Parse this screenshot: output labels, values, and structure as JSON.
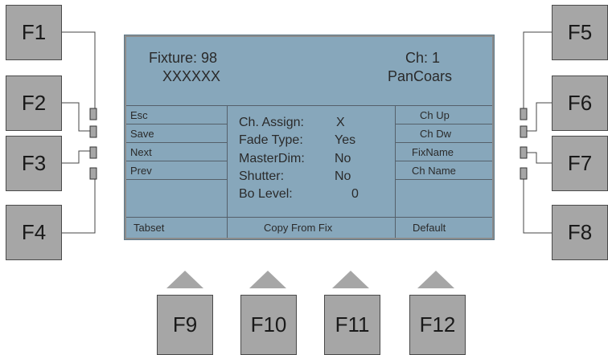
{
  "function_keys": {
    "f1": "F1",
    "f2": "F2",
    "f3": "F3",
    "f4": "F4",
    "f5": "F5",
    "f6": "F6",
    "f7": "F7",
    "f8": "F8",
    "f9": "F9",
    "f10": "F10",
    "f11": "F11",
    "f12": "F12"
  },
  "display": {
    "fixture_label": "Fixture: 98",
    "fixture_name": "XXXXXX",
    "channel_label": "Ch: 1",
    "channel_name": "PanCoars",
    "left_softkeys": [
      "Esc",
      "Save",
      "Next",
      "Prev",
      ""
    ],
    "right_softkeys": [
      "Ch Up",
      "Ch Dw",
      "FixName",
      "Ch Name",
      ""
    ],
    "fields": [
      {
        "label": "Ch. Assign:",
        "value": "X"
      },
      {
        "label": "Fade Type:",
        "value": "Yes"
      },
      {
        "label": "MasterDim:",
        "value": "No"
      },
      {
        "label": "Shutter:",
        "value": "No"
      },
      {
        "label": "Bo Level:",
        "value": "0"
      }
    ],
    "bottom_bar": {
      "left": "Tabset",
      "center": "Copy From Fix",
      "right": "Default"
    }
  },
  "colors": {
    "lcd_background": "#87a7bb",
    "key_fill": "#a6a6a6",
    "text": "#2a2a2a"
  }
}
